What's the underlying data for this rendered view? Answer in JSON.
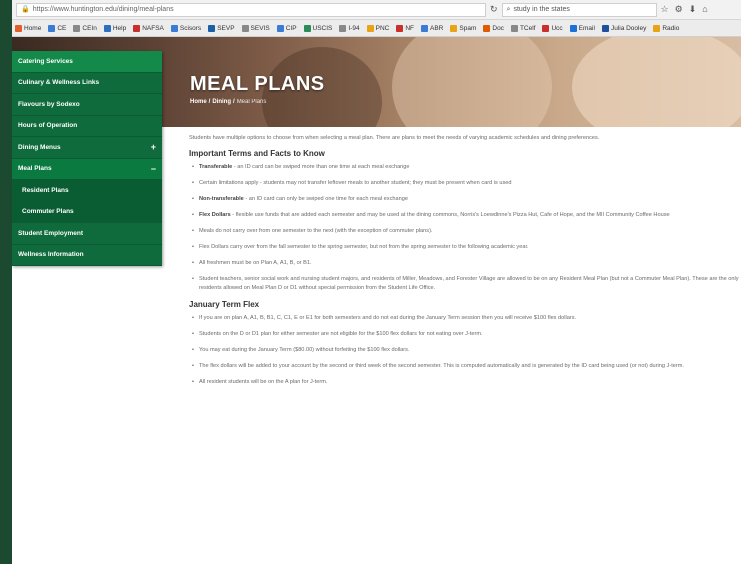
{
  "browser": {
    "url": "https://www.huntington.edu/dining/meal-plans",
    "search": "study in the states",
    "bookmarks": [
      "Home",
      "CE",
      "CEIn",
      "Help",
      "NAFSA",
      "Scisors",
      "SEVP",
      "SEVIS",
      "CIP",
      "USCIS",
      "I-94",
      "PNC",
      "NF",
      "ABR",
      "Spam",
      "Doc",
      "TCelf",
      "Ucc",
      "Email",
      "Julia Dooley",
      "Radio"
    ]
  },
  "hero": {
    "title": "MEAL PLANS",
    "breadcrumb": {
      "home": "Home",
      "sep": " / ",
      "dining": "Dining",
      "current": "Meal Plans"
    }
  },
  "sidebar": {
    "items": [
      {
        "label": "Catering Services",
        "toggle": ""
      },
      {
        "label": "Culinary & Wellness Links",
        "toggle": ""
      },
      {
        "label": "Flavours by Sodexo",
        "toggle": ""
      },
      {
        "label": "Hours of Operation",
        "toggle": ""
      },
      {
        "label": "Dining Menus",
        "toggle": "+"
      },
      {
        "label": "Meal Plans",
        "toggle": "−"
      },
      {
        "label": "Resident Plans",
        "toggle": ""
      },
      {
        "label": "Commuter Plans",
        "toggle": ""
      },
      {
        "label": "Student Employment",
        "toggle": ""
      },
      {
        "label": "Wellness Information",
        "toggle": ""
      }
    ]
  },
  "content": {
    "intro": "Students have multiple options to choose from when selecting a meal plan. There are plans to meet the needs of varying academic schedules and dining preferences.",
    "section1_title": "Important Terms and Facts to Know",
    "section1": [
      {
        "term": "Transferable",
        "text": " - an ID card can be swiped more than one time at each meal exchange"
      },
      {
        "term": "",
        "text": "Certain limitations apply - students may not transfer leftover meals to another student; they must be present when card is used"
      },
      {
        "term": "Non-transferable",
        "text": " - an ID card can only be swiped one time for each meal exchange"
      },
      {
        "term": "Flex Dollars",
        "text": " - flexible use funds that are added each semester and may be used at the dining commons, Norris's Loewdinne's Pizza Hut, Cafe of Hope, and the MII Community Coffee House"
      },
      {
        "term": "",
        "text": "Meals do not carry over from one semester to the next (with the exception of commuter plans)."
      },
      {
        "term": "",
        "text": "Flex Dollars carry over from the fall semester to the spring semester, but not from the spring semester to the following academic year."
      },
      {
        "term": "",
        "text": "All freshmen must be on Plan A, A1, B, or B1."
      },
      {
        "term": "",
        "text": "Student teachers, senior social work and nursing student majors, and residents of Miller, Meadows, and Forester Village are allowed to be on any Resident Meal Plan (but not a Commuter Meal Plan). These are the only residents allowed on Meal Plan D or D1 without special permission from the Student Life Office."
      }
    ],
    "section2_title": "January Term Flex",
    "section2": [
      "If you are on plan A, A1, B, B1, C, C1, E or E1 for both semesters and do not eat during the January Term session then you will receive $100 flex dollars.",
      "Students on the D or D1 plan for either semester are not eligible for the $100 flex dollars for not eating over J-term.",
      "You may eat during the January Term ($80.00) without forfeiting the $100 flex dollars.",
      "The flex dollars will be added to your account by the second or third week of the second semester. This is computed automatically and is generated by the ID card being used (or not) during J-term.",
      "All resident students will be on the A plan for J-term."
    ]
  },
  "colors": {
    "sidebar": "#0f6b3c",
    "sidebar_active": "#138a4a",
    "sidebar_sub": "#0a5d33",
    "frame": "#1c4a31"
  }
}
